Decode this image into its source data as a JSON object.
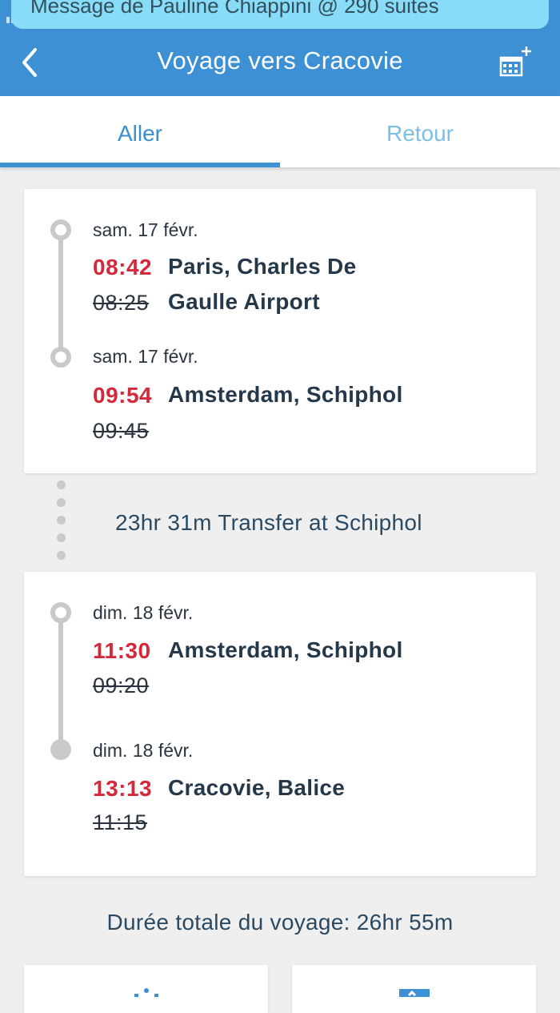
{
  "notification": {
    "text": "Message de Pauline Chiappini @  290 suites"
  },
  "header": {
    "title": "Voyage vers Cracovie"
  },
  "tabs": [
    {
      "label": "Aller"
    },
    {
      "label": "Retour"
    }
  ],
  "legs": [
    {
      "departure": {
        "date": "sam. 17 févr.",
        "time_new": "08:42",
        "time_old": "08:25",
        "place_line1": "Paris, Charles De",
        "place_line2": "Gaulle Airport"
      },
      "arrival": {
        "date": "sam. 17 févr.",
        "time_new": "09:54",
        "time_old": "09:45",
        "place": "Amsterdam, Schiphol"
      }
    },
    {
      "departure": {
        "date": "dim. 18 févr.",
        "time_new": "11:30",
        "time_old": "09:20",
        "place": "Amsterdam, Schiphol"
      },
      "arrival": {
        "date": "dim. 18 févr.",
        "time_new": "13:13",
        "time_old": "11:15",
        "place": "Cracovie, Balice"
      }
    }
  ],
  "transfer": {
    "text": "23hr 31m Transfer at Schiphol"
  },
  "total": {
    "text": "Durée totale du voyage: 26hr 55m"
  },
  "colors": {
    "accent": "#3e90d5",
    "delay_red": "#d3293b",
    "timeline_gray": "#c9c9c9",
    "text_dark": "#25384a"
  }
}
